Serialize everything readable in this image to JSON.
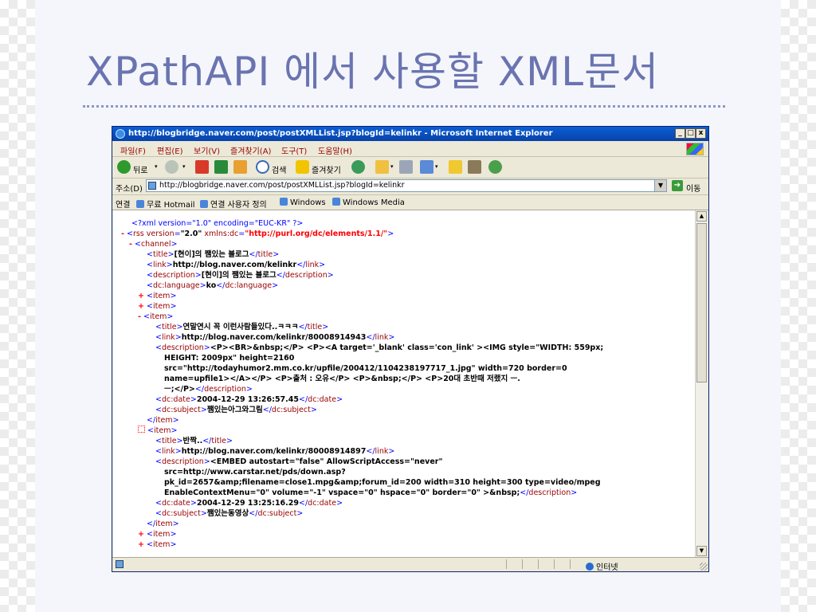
{
  "slide": {
    "title": "XPathAPI 에서 사용할 XML문서"
  },
  "window": {
    "title": "http://blogbridge.naver.com/post/postXMLList.jsp?blogId=kelinkr - Microsoft Internet Explorer",
    "min_label": "_",
    "max_label": "□",
    "close_label": "x"
  },
  "menu": {
    "items": [
      "파일(F)",
      "편집(E)",
      "보기(V)",
      "즐겨찾기(A)",
      "도구(T)",
      "도움말(H)"
    ]
  },
  "toolbar": {
    "back_label": "뒤로",
    "search_label": "검색",
    "favorites_label": "즐겨찾기"
  },
  "address": {
    "label": "주소(D)",
    "url": "http://blogbridge.naver.com/post/postXMLList.jsp?blogId=kelinkr",
    "go_label": "이동"
  },
  "links": {
    "label": "연결",
    "items": [
      "무료 Hotmail",
      "연결 사용자 정의",
      "Windows",
      "Windows Media"
    ]
  },
  "status": {
    "zone": "인터넷"
  },
  "xml": {
    "decl": "<?xml version=\"1.0\" encoding=\"EUC-KR\" ?>",
    "rss_version": "\"2.0\"",
    "rss_ns": "\"http://purl.org/dc/elements/1.1/\"",
    "channel_title": "[현이]의 쨈있는 블로그",
    "channel_link": "http://blog.naver.com/kelinkr",
    "channel_desc": "[현이]의 쨈있는 블로그",
    "channel_lang": "ko",
    "item1_title": "연말연시 꼭 이런사람들있다..ㅋㅋㅋ",
    "item1_link": "http://blog.naver.com/kelinkr/80008914943",
    "item1_desc_1": "<P><BR>&nbsp;</P> <P><A target='_blank' class='con_link' ><IMG style=\"WIDTH: 559px;",
    "item1_desc_2": "HEIGHT: 2009px\" height=2160",
    "item1_desc_3": "src=\"http://todayhumor2.mm.co.kr/upfile/200412/1104238197717_1.jpg\" width=720 border=0",
    "item1_desc_4": "name=upfile1></A></P> <P>출처 : 오유</P> <P>&nbsp;</P> <P>20대 초반때 저랬지 ㅡ.",
    "item1_desc_5": "ㅡ;</P>",
    "item1_date": "2004-12-29 13:26:57.45",
    "item1_subject": "쨈있는아그와그림",
    "item2_title": "반짝..",
    "item2_link": "http://blog.naver.com/kelinkr/80008914897",
    "item2_desc_1": "<EMBED autostart=\"false\" AllowScriptAccess=\"never\"",
    "item2_desc_2": "src=http://www.carstar.net/pds/down.asp?",
    "item2_desc_3": "pk_id=2657&amp;filename=close1.mpg&amp;forum_id=200 width=310 height=300 type=video/mpeg",
    "item2_desc_4": "EnableContextMenu=\"0\" volume=\"-1\" vspace=\"0\" hspace=\"0\" border=\"0\" >&nbsp;",
    "item2_date": "2004-12-29 13:25:16.29",
    "item2_subject": "쨈있는동영상"
  }
}
